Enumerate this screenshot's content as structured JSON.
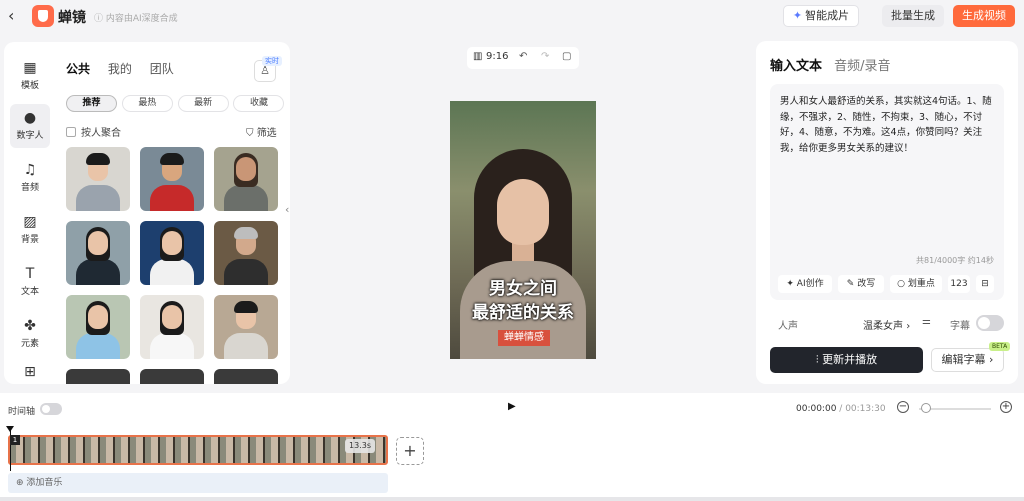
{
  "topbar": {
    "brand": "蝉镜",
    "ai_note": "ⓘ 内容由AI深度合成",
    "smart_button": "智能成片",
    "batch_button": "批量生成",
    "generate_button": "生成视频",
    "colors": {
      "accent": "#ff6a3c"
    }
  },
  "sidebar": {
    "items": [
      {
        "label": "模板",
        "icon": "template-icon"
      },
      {
        "label": "数字人",
        "icon": "digital-human-icon",
        "active": true
      },
      {
        "label": "音频",
        "icon": "music-note-icon"
      },
      {
        "label": "背景",
        "icon": "background-icon"
      },
      {
        "label": "文本",
        "icon": "text-icon"
      },
      {
        "label": "元素",
        "icon": "elements-icon"
      },
      {
        "label": "",
        "icon": "folder-upload-icon"
      }
    ]
  },
  "library": {
    "tabs": [
      "公共",
      "我的",
      "团队"
    ],
    "active_tab": "公共",
    "realtime_badge": "实时",
    "filter_pills": [
      "推荐",
      "最热",
      "最新",
      "收藏"
    ],
    "active_pill": "推荐",
    "aggregate_label": "按人聚合",
    "filter_label": "筛选"
  },
  "preview": {
    "ratio": "9:16",
    "title_line1": "男女之间",
    "title_line2": "最舒适的关系",
    "tag": "蝉蝉情感"
  },
  "editor": {
    "tabs": [
      "输入文本",
      "音频/录音"
    ],
    "active_tab": "输入文本",
    "script_text": "男人和女人最舒适的关系，其实就这4句话。1、随缘，不强求，2、随性，不拘束，3、随心，不讨好，4、随意，不为难。这4点，你赞同吗？关注我，给你更多男女关系的建议！",
    "char_count": "共81/4000字 约14秒",
    "tools": [
      "AI创作",
      "改写",
      "划重点",
      "123"
    ],
    "voice_label": "人声",
    "voice_value": "温柔女声",
    "caption_label": "字幕",
    "caption_on": false,
    "play_button": "更新并播放",
    "edit_caption_button": "编辑字幕",
    "beta_badge": "BETA"
  },
  "timeline": {
    "label": "时间轴",
    "current_time": "00:00:00",
    "total_time": "/ 00:13:30",
    "clip_index": "1",
    "clip_duration": "13.3s",
    "add_music": "添加音乐"
  }
}
